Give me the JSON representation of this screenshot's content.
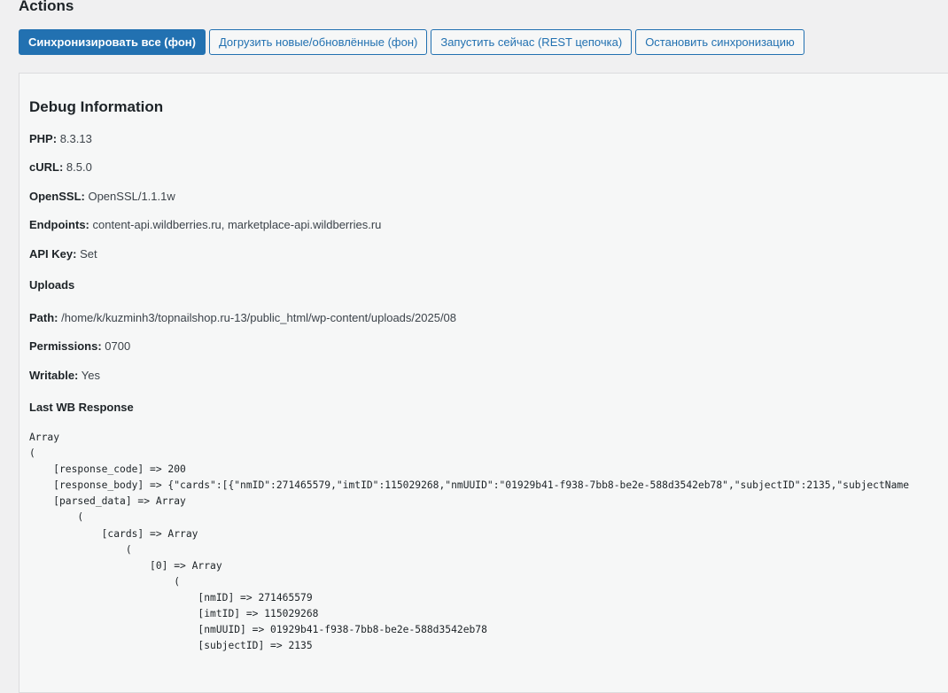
{
  "actions": {
    "heading": "Actions",
    "buttons": {
      "sync_all": "Синхронизировать все (фон)",
      "load_new": "Догрузить новые/обновлённые (фон)",
      "run_now": "Запустить сейчас (REST цепочка)",
      "stop_sync": "Остановить синхронизацию"
    }
  },
  "debug": {
    "title": "Debug Information",
    "php_label": "PHP:",
    "php_value": "8.3.13",
    "curl_label": "cURL:",
    "curl_value": "8.5.0",
    "openssl_label": "OpenSSL:",
    "openssl_value": "OpenSSL/1.1.1w",
    "endpoints_label": "Endpoints:",
    "endpoints_value": "content-api.wildberries.ru, marketplace-api.wildberries.ru",
    "apikey_label": "API Key:",
    "apikey_value": "Set",
    "uploads_heading": "Uploads",
    "path_label": "Path:",
    "path_value": "/home/k/kuzminh3/topnailshop.ru-13/public_html/wp-content/uploads/2025/08",
    "permissions_label": "Permissions:",
    "permissions_value": "0700",
    "writable_label": "Writable:",
    "writable_value": "Yes",
    "last_response_heading": "Last WB Response",
    "response_dump": "Array\n(\n    [response_code] => 200\n    [response_body] => {\"cards\":[{\"nmID\":271465579,\"imtID\":115029268,\"nmUUID\":\"01929b41-f938-7bb8-be2e-588d3542eb78\",\"subjectID\":2135,\"subjectName\n    [parsed_data] => Array\n        (\n            [cards] => Array\n                (\n                    [0] => Array\n                        (\n                            [nmID] => 271465579\n                            [imtID] => 115029268\n                            [nmUUID] => 01929b41-f938-7bb8-be2e-588d3542eb78\n                            [subjectID] => 2135"
  }
}
